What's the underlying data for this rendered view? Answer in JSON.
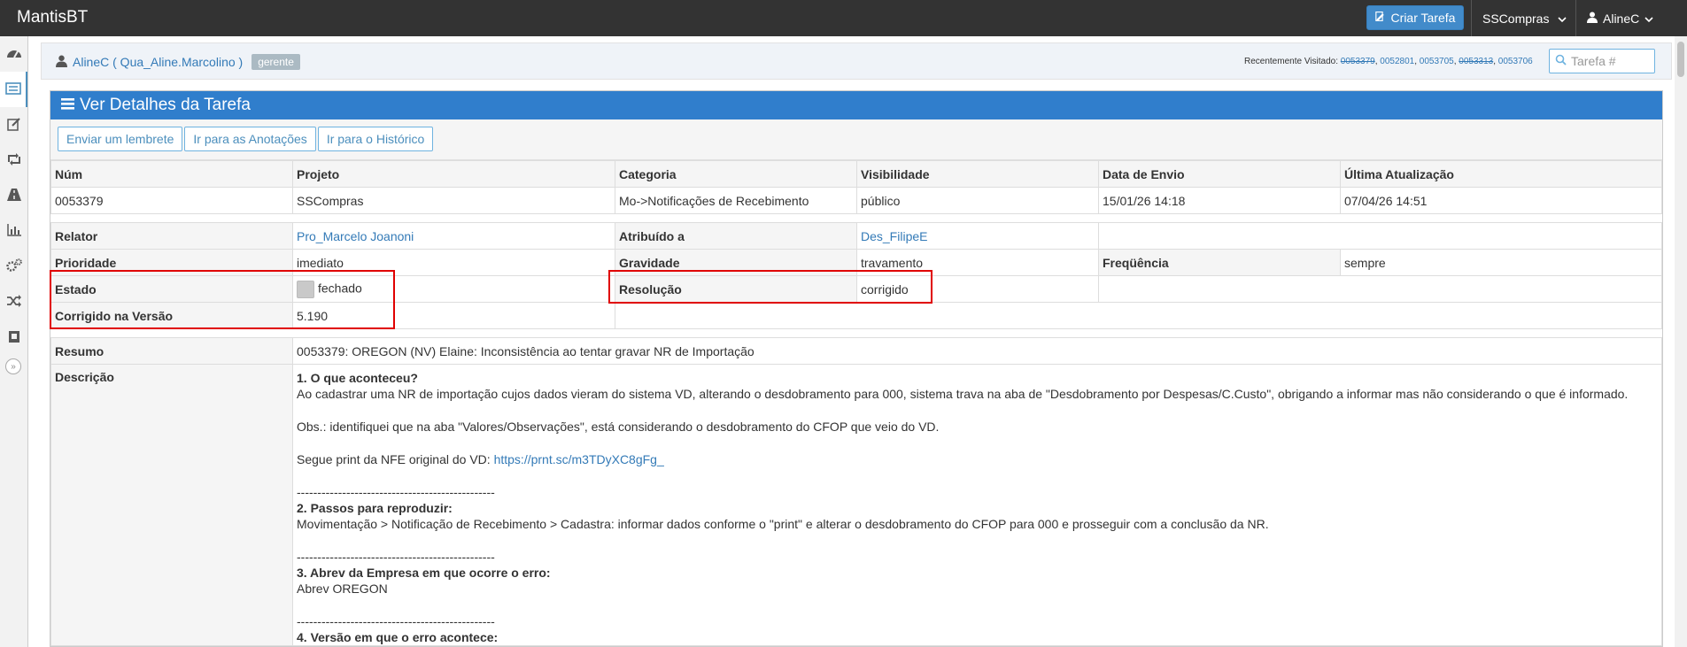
{
  "app": {
    "brand": "MantisBT"
  },
  "navbar": {
    "create_label": "Criar Tarefa",
    "project": "SSCompras",
    "user": "AlineC"
  },
  "sidebar": {
    "icons": [
      "dashboard-icon",
      "list-icon",
      "edit-icon",
      "retweet-icon",
      "road-icon",
      "bar-chart-icon",
      "gears-icon",
      "random-icon",
      "book-icon"
    ]
  },
  "breadcrumbs": {
    "user_link": "AlineC ( Qua_Aline.Marcolino )",
    "role": "gerente",
    "recent_label": "Recentemente Visitado:",
    "recent": [
      {
        "id": "0053379",
        "strike": true
      },
      {
        "id": "0052801",
        "strike": false
      },
      {
        "id": "0053705",
        "strike": false
      },
      {
        "id": "0053313",
        "strike": true
      },
      {
        "id": "0053706",
        "strike": false
      }
    ],
    "search_placeholder": "Tarefa #"
  },
  "widget": {
    "title": "Ver Detalhes da Tarefa",
    "buttons": [
      "Enviar um lembrete",
      "Ir para as Anotações",
      "Ir para o Histórico"
    ]
  },
  "summary_table": {
    "headers": [
      "Núm",
      "Projeto",
      "Categoria",
      "Visibilidade",
      "Data de Envio",
      "Última Atualização"
    ],
    "values": [
      "0053379",
      "SSCompras",
      "Mo->Notificações de Recebimento",
      "público",
      "15/01/26 14:18",
      "07/04/26 14:51"
    ]
  },
  "details": {
    "relator_label": "Relator",
    "relator": "Pro_Marcelo Joanoni",
    "atribuido_label": "Atribuído a",
    "atribuido": "Des_FilipeE",
    "prioridade_label": "Prioridade",
    "prioridade": "imediato",
    "gravidade_label": "Gravidade",
    "gravidade": "travamento",
    "frequencia_label": "Freqüência",
    "frequencia": "sempre",
    "estado_label": "Estado",
    "estado": "fechado",
    "resolucao_label": "Resolução",
    "resolucao": "corrigido",
    "corrigido_label": "Corrigido na Versão",
    "corrigido": "5.190",
    "resumo_label": "Resumo",
    "resumo": "0053379: OREGON (NV) Elaine: Inconsistência ao tentar gravar NR de Importação",
    "descricao_label": "Descrição",
    "descricao": {
      "h1": "1. O que aconteceu?",
      "p1": "Ao cadastrar uma NR de importação cujos dados vieram do sistema VD, alterando o desdobramento para 000, sistema trava na aba de \"Desdobramento por Despesas/C.Custo\", obrigando a informar mas não considerando o que é informado.",
      "p2": "Obs.: identifiquei que na aba \"Valores/Observações\", está considerando o desdobramento do CFOP que veio do VD.",
      "p3": "Segue print da NFE original do VD:",
      "link": "https://prnt.sc/m3TDyXC8gFg_",
      "sep": "------------------------------------------------",
      "h2": "2. Passos para reproduzir:",
      "p4": "Movimentação > Notificação de Recebimento > Cadastra: informar dados conforme o \"print\" e alterar o desdobramento do CFOP para 000 e prosseguir com a conclusão da NR.",
      "h3": "3. Abrev da Empresa em que ocorre o erro:",
      "p5": "Abrev OREGON",
      "h4": "4. Versão em que o erro acontece:"
    }
  }
}
